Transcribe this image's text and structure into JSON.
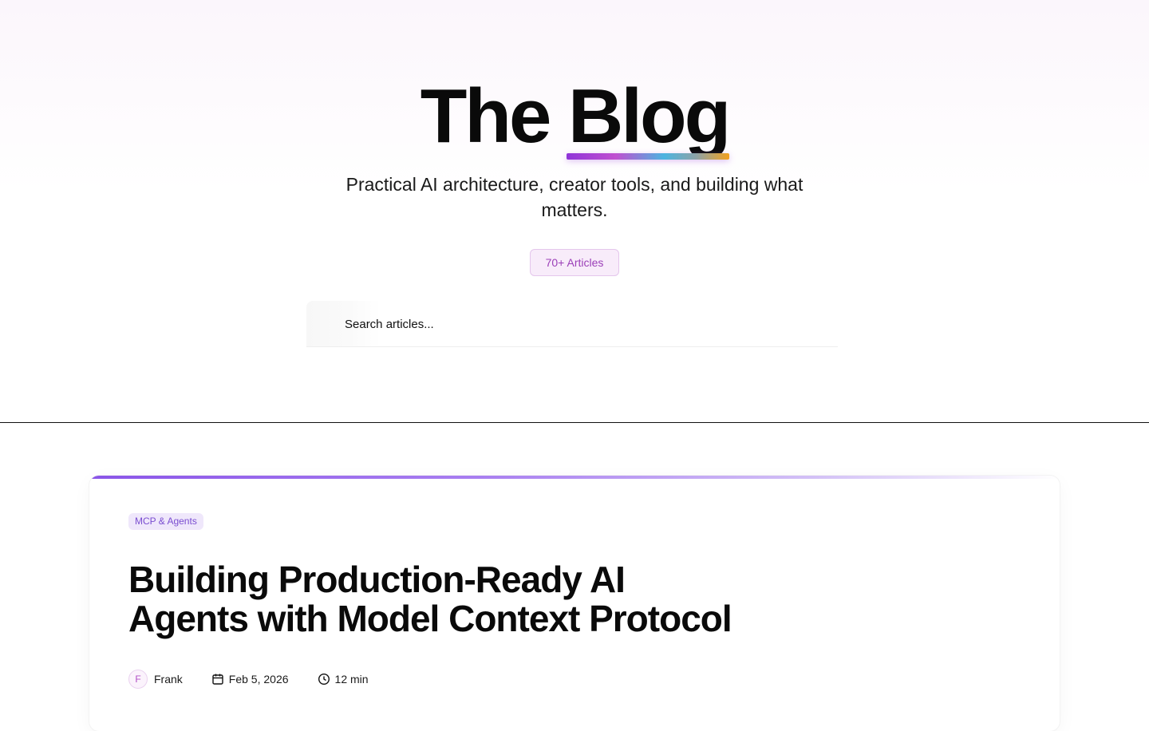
{
  "hero": {
    "title_part1": "The",
    "title_part2": "Blog",
    "subtitle": "Practical AI architecture, creator tools, and building what matters.",
    "badge": "70+ Articles"
  },
  "search": {
    "placeholder": "Search articles..."
  },
  "featured_post": {
    "category": "MCP & Agents",
    "title_line1": "Building Production-Ready AI",
    "title_line2": "Agents with Model Context Protocol",
    "author_initial": "F",
    "author": "Frank",
    "date": "Feb 5, 2026",
    "read_time": "12 min"
  },
  "colors": {
    "accent_purple": "#8a55e8",
    "badge_text": "#9b3fb8",
    "underline_gradient": [
      "#8f34d8",
      "#c04fd0",
      "#4cb4e0",
      "#f3a11e"
    ]
  },
  "icons": {
    "search": "search-icon",
    "calendar": "calendar-icon",
    "clock": "clock-icon"
  }
}
